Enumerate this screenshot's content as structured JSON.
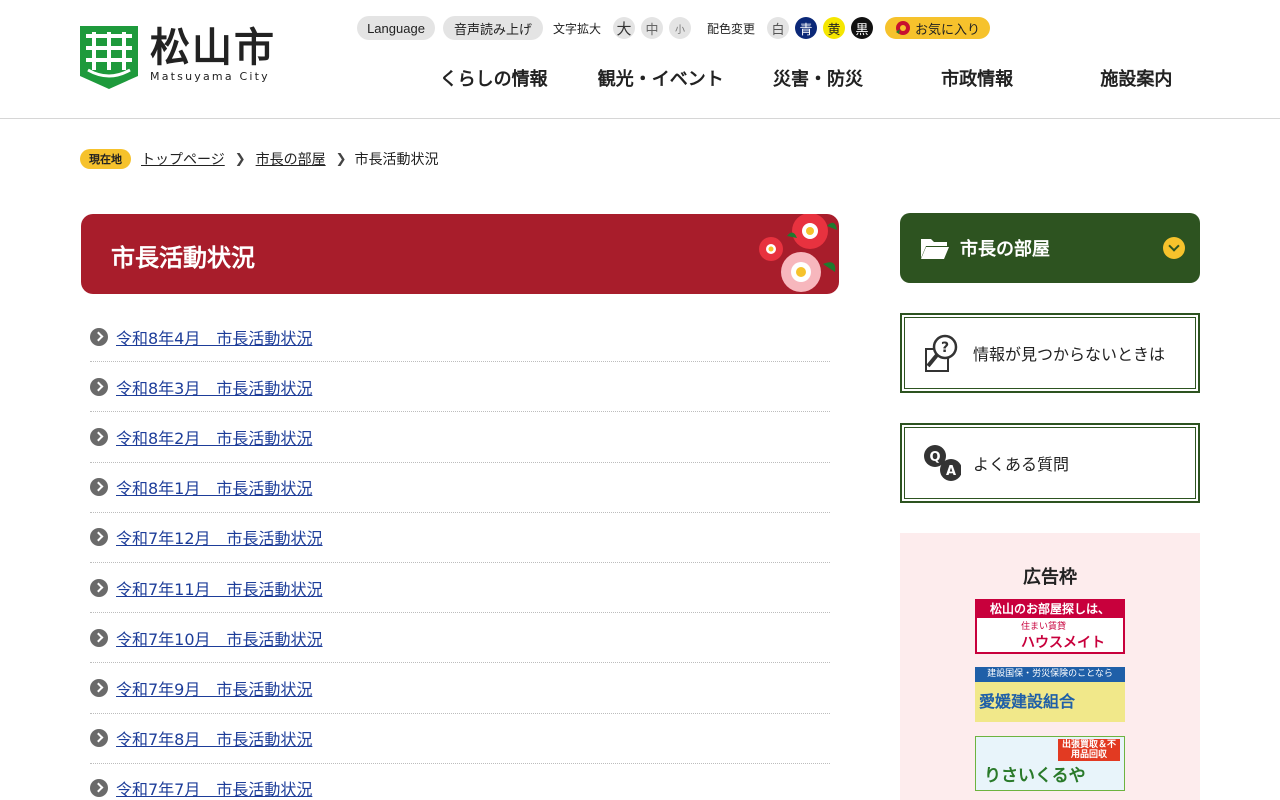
{
  "header": {
    "logo_jp": "松山市",
    "logo_en": "Matsuyama City",
    "language_label": "Language",
    "voice_label": "音声読み上げ",
    "font_size_label": "文字拡大",
    "font_sizes": [
      "大",
      "中",
      "小"
    ],
    "color_label": "配色変更",
    "colors": [
      "白",
      "青",
      "黄",
      "黒"
    ],
    "favorite_label": "お気に入り",
    "nav": [
      "くらしの情報",
      "観光・イベント",
      "災害・防災",
      "市政情報",
      "施設案内"
    ]
  },
  "breadcrumb": {
    "badge": "現在地",
    "items": [
      "トップページ",
      "市長の部屋"
    ],
    "current": "市長活動状況"
  },
  "main": {
    "title": "市長活動状況",
    "links": [
      "令和8年4月　市長活動状況",
      "令和8年3月　市長活動状況",
      "令和8年2月　市長活動状況",
      "令和8年1月　市長活動状況",
      "令和7年12月　市長活動状況",
      "令和7年11月　市長活動状況",
      "令和7年10月　市長活動状況",
      "令和7年9月　市長活動状況",
      "令和7年8月　市長活動状況",
      "令和7年7月　市長活動状況"
    ]
  },
  "sidebar": {
    "section_title": "市長の部屋",
    "not_found_label": "情報が見つからないときは",
    "faq_label": "よくある質問",
    "ad_title": "広告枠",
    "ads": {
      "ad1_top": "松山のお部屋探しは、",
      "ad1_sub": "住まい賃貸",
      "ad1_brand": "ハウスメイト",
      "ad2_top": "建設国保・労災保険のことなら",
      "ad2_main": "愛媛建設組合",
      "ad3_badge": "出張買取＆不用品回収",
      "ad3_main": "りさいくるや"
    }
  },
  "colors": {
    "heading_red": "#a81d2b",
    "sidebar_green": "#2d5320",
    "accent_yellow": "#f6c22c",
    "link_blue": "#1d3d99"
  }
}
